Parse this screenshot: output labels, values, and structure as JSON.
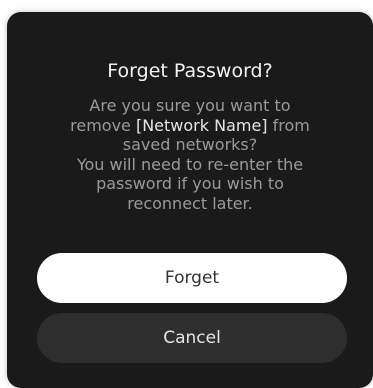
{
  "dialog": {
    "title": "Forget Password?",
    "message": {
      "line1": "Are you sure you want to",
      "line2_before": "remove ",
      "network_name": "[Network Name]",
      "line2_after": " from",
      "line3": "saved networks?",
      "line4": "You will need to re-enter the",
      "line5": "password if you wish to",
      "line6": "reconnect later."
    },
    "forget_label": "Forget",
    "cancel_label": "Cancel"
  },
  "colors": {
    "dialog_background": "#1a1a1a",
    "title_text": "#f2f2f2",
    "message_text": "#9a9a9a",
    "network_name_text": "#e6e6e6",
    "forget_button_background": "#ffffff",
    "forget_button_text": "#333333",
    "cancel_button_background": "#2e2e2e",
    "cancel_button_text": "#e6e6e6"
  }
}
